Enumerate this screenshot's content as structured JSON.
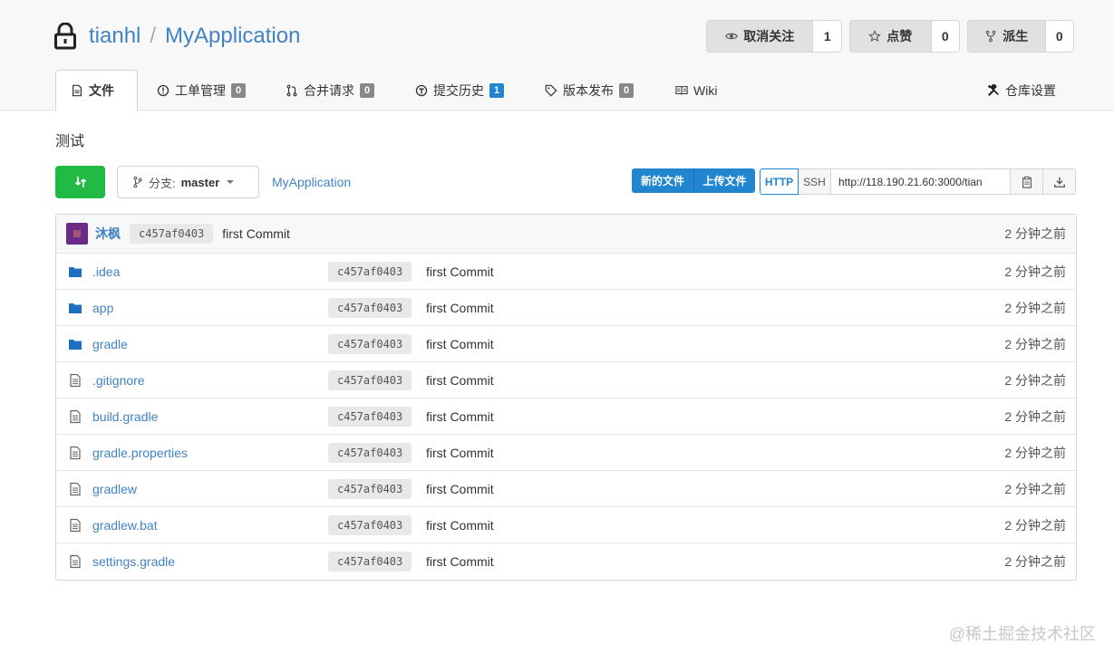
{
  "repo": {
    "owner": "tianhl",
    "separator": "/",
    "name": "MyApplication",
    "description": "测试"
  },
  "actions": {
    "watch": {
      "label": "取消关注",
      "count": "1"
    },
    "star": {
      "label": "点赞",
      "count": "0"
    },
    "fork": {
      "label": "派生",
      "count": "0"
    }
  },
  "tabs": [
    {
      "label": "文件",
      "icon": "code-icon"
    },
    {
      "label": "工单管理",
      "badge": "0",
      "icon": "issue-icon"
    },
    {
      "label": "合并请求",
      "badge": "0",
      "icon": "pull-request-icon"
    },
    {
      "label": "提交历史",
      "badge": "1",
      "icon": "history-icon"
    },
    {
      "label": "版本发布",
      "badge": "0",
      "icon": "tag-icon"
    },
    {
      "label": "Wiki",
      "icon": "book-icon"
    },
    {
      "label": "仓库设置",
      "icon": "tools-icon"
    }
  ],
  "toolbar": {
    "branch_prefix": "分支:",
    "branch": "master",
    "path": "MyApplication",
    "new_file": "新的文件",
    "upload_file": "上传文件",
    "http": "HTTP",
    "ssh": "SSH",
    "clone_url": "http://118.190.21.60:3000/tian"
  },
  "latest_commit": {
    "author": "沐枫",
    "sha": "c457af0403",
    "message": "first Commit",
    "time": "2 分钟之前"
  },
  "files": [
    {
      "name": ".idea",
      "type": "folder",
      "sha": "c457af0403",
      "message": "first Commit",
      "time": "2 分钟之前"
    },
    {
      "name": "app",
      "type": "folder",
      "sha": "c457af0403",
      "message": "first Commit",
      "time": "2 分钟之前"
    },
    {
      "name": "gradle",
      "type": "folder",
      "sha": "c457af0403",
      "message": "first Commit",
      "time": "2 分钟之前"
    },
    {
      "name": ".gitignore",
      "type": "file",
      "sha": "c457af0403",
      "message": "first Commit",
      "time": "2 分钟之前"
    },
    {
      "name": "build.gradle",
      "type": "file",
      "sha": "c457af0403",
      "message": "first Commit",
      "time": "2 分钟之前"
    },
    {
      "name": "gradle.properties",
      "type": "file",
      "sha": "c457af0403",
      "message": "first Commit",
      "time": "2 分钟之前"
    },
    {
      "name": "gradlew",
      "type": "file",
      "sha": "c457af0403",
      "message": "first Commit",
      "time": "2 分钟之前"
    },
    {
      "name": "gradlew.bat",
      "type": "file",
      "sha": "c457af0403",
      "message": "first Commit",
      "time": "2 分钟之前"
    },
    {
      "name": "settings.gradle",
      "type": "file",
      "sha": "c457af0403",
      "message": "first Commit",
      "time": "2 分钟之前"
    }
  ],
  "watermark": "@稀土掘金技术社区",
  "colors": {
    "link": "#4183c4",
    "primary": "#2185d0",
    "success": "#21ba45"
  }
}
